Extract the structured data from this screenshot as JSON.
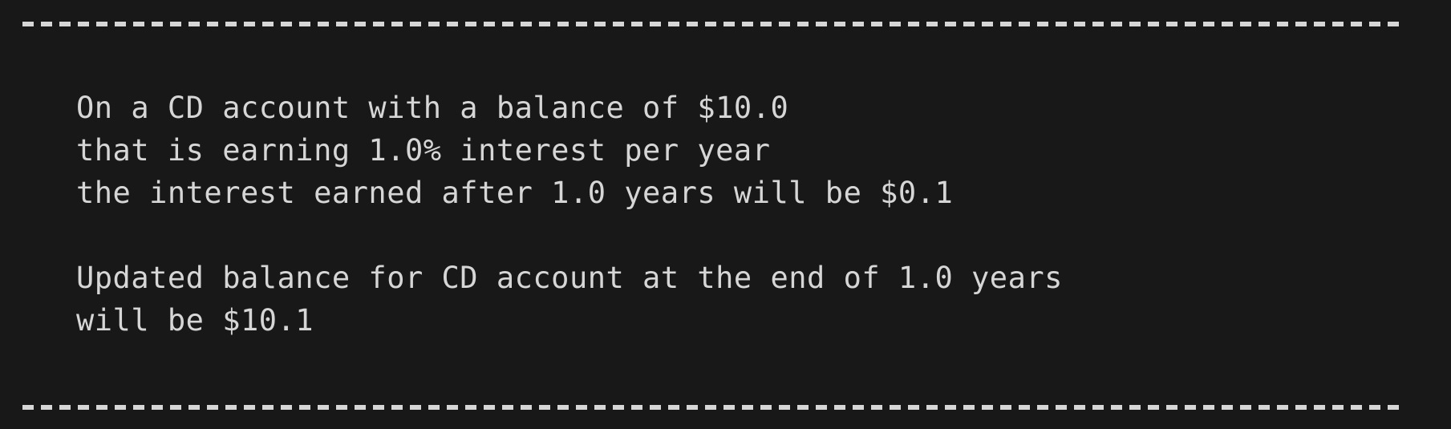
{
  "terminal": {
    "lines": [
      "On a CD account with a balance of $10.0",
      "that is earning 1.0% interest per year",
      "the interest earned after 1.0 years will be $0.1",
      "Updated balance for CD account at the end of 1.0 years",
      "will be $10.1"
    ],
    "colors": {
      "background": "#181818",
      "text": "#d6d6d6"
    }
  }
}
